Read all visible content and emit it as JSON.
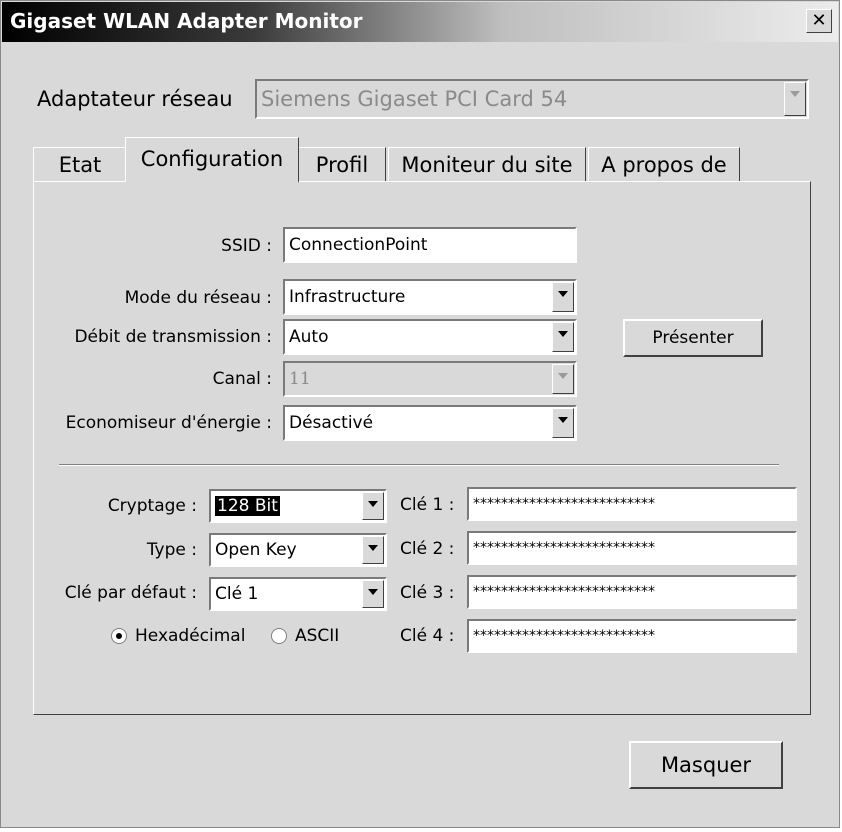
{
  "window": {
    "title": "Gigaset WLAN Adapter Monitor",
    "close_glyph": "✕"
  },
  "adapter": {
    "label": "Adaptateur réseau",
    "value": "Siemens Gigaset PCI Card 54"
  },
  "tabs": [
    {
      "label": "Etat"
    },
    {
      "label": "Configuration",
      "active": true
    },
    {
      "label": "Profil"
    },
    {
      "label": "Moniteur du site"
    },
    {
      "label": "A propos de"
    }
  ],
  "config": {
    "ssid_label": "SSID :",
    "ssid_value": "ConnectionPoint",
    "mode_label": "Mode du réseau :",
    "mode_value": "Infrastructure",
    "rate_label": "Débit de transmission :",
    "rate_value": "Auto",
    "channel_label": "Canal :",
    "channel_value": "11",
    "power_label": "Economiseur d'énergie :",
    "power_value": "Désactivé",
    "present_button": "Présenter"
  },
  "security": {
    "encryption_label": "Cryptage :",
    "encryption_value": "128 Bit",
    "type_label": "Type :",
    "type_value": "Open Key",
    "default_key_label": "Clé par défaut :",
    "default_key_value": "Clé 1",
    "hex_label": "Hexadécimal",
    "ascii_label": "ASCII",
    "format_selected": "Hexadécimal",
    "keys": [
      {
        "label": "Clé 1 :",
        "value": "**************************"
      },
      {
        "label": "Clé 2 :",
        "value": "**************************"
      },
      {
        "label": "Clé 3 :",
        "value": "**************************"
      },
      {
        "label": "Clé 4 :",
        "value": "**************************"
      }
    ]
  },
  "footer": {
    "hide_button": "Masquer"
  }
}
